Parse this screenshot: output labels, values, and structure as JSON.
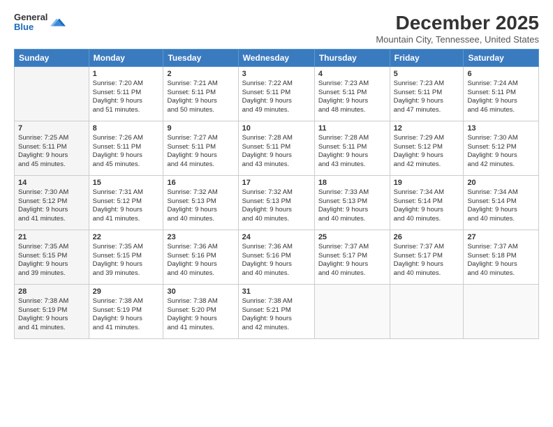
{
  "logo": {
    "general": "General",
    "blue": "Blue"
  },
  "header": {
    "title": "December 2025",
    "location": "Mountain City, Tennessee, United States"
  },
  "weekdays": [
    "Sunday",
    "Monday",
    "Tuesday",
    "Wednesday",
    "Thursday",
    "Friday",
    "Saturday"
  ],
  "weeks": [
    [
      {
        "day": "",
        "content": ""
      },
      {
        "day": "1",
        "content": "Sunrise: 7:20 AM\nSunset: 5:11 PM\nDaylight: 9 hours\nand 51 minutes."
      },
      {
        "day": "2",
        "content": "Sunrise: 7:21 AM\nSunset: 5:11 PM\nDaylight: 9 hours\nand 50 minutes."
      },
      {
        "day": "3",
        "content": "Sunrise: 7:22 AM\nSunset: 5:11 PM\nDaylight: 9 hours\nand 49 minutes."
      },
      {
        "day": "4",
        "content": "Sunrise: 7:23 AM\nSunset: 5:11 PM\nDaylight: 9 hours\nand 48 minutes."
      },
      {
        "day": "5",
        "content": "Sunrise: 7:23 AM\nSunset: 5:11 PM\nDaylight: 9 hours\nand 47 minutes."
      },
      {
        "day": "6",
        "content": "Sunrise: 7:24 AM\nSunset: 5:11 PM\nDaylight: 9 hours\nand 46 minutes."
      }
    ],
    [
      {
        "day": "7",
        "content": "Sunrise: 7:25 AM\nSunset: 5:11 PM\nDaylight: 9 hours\nand 45 minutes."
      },
      {
        "day": "8",
        "content": "Sunrise: 7:26 AM\nSunset: 5:11 PM\nDaylight: 9 hours\nand 45 minutes."
      },
      {
        "day": "9",
        "content": "Sunrise: 7:27 AM\nSunset: 5:11 PM\nDaylight: 9 hours\nand 44 minutes."
      },
      {
        "day": "10",
        "content": "Sunrise: 7:28 AM\nSunset: 5:11 PM\nDaylight: 9 hours\nand 43 minutes."
      },
      {
        "day": "11",
        "content": "Sunrise: 7:28 AM\nSunset: 5:11 PM\nDaylight: 9 hours\nand 43 minutes."
      },
      {
        "day": "12",
        "content": "Sunrise: 7:29 AM\nSunset: 5:12 PM\nDaylight: 9 hours\nand 42 minutes."
      },
      {
        "day": "13",
        "content": "Sunrise: 7:30 AM\nSunset: 5:12 PM\nDaylight: 9 hours\nand 42 minutes."
      }
    ],
    [
      {
        "day": "14",
        "content": "Sunrise: 7:30 AM\nSunset: 5:12 PM\nDaylight: 9 hours\nand 41 minutes."
      },
      {
        "day": "15",
        "content": "Sunrise: 7:31 AM\nSunset: 5:12 PM\nDaylight: 9 hours\nand 41 minutes."
      },
      {
        "day": "16",
        "content": "Sunrise: 7:32 AM\nSunset: 5:13 PM\nDaylight: 9 hours\nand 40 minutes."
      },
      {
        "day": "17",
        "content": "Sunrise: 7:32 AM\nSunset: 5:13 PM\nDaylight: 9 hours\nand 40 minutes."
      },
      {
        "day": "18",
        "content": "Sunrise: 7:33 AM\nSunset: 5:13 PM\nDaylight: 9 hours\nand 40 minutes."
      },
      {
        "day": "19",
        "content": "Sunrise: 7:34 AM\nSunset: 5:14 PM\nDaylight: 9 hours\nand 40 minutes."
      },
      {
        "day": "20",
        "content": "Sunrise: 7:34 AM\nSunset: 5:14 PM\nDaylight: 9 hours\nand 40 minutes."
      }
    ],
    [
      {
        "day": "21",
        "content": "Sunrise: 7:35 AM\nSunset: 5:15 PM\nDaylight: 9 hours\nand 39 minutes."
      },
      {
        "day": "22",
        "content": "Sunrise: 7:35 AM\nSunset: 5:15 PM\nDaylight: 9 hours\nand 39 minutes."
      },
      {
        "day": "23",
        "content": "Sunrise: 7:36 AM\nSunset: 5:16 PM\nDaylight: 9 hours\nand 40 minutes."
      },
      {
        "day": "24",
        "content": "Sunrise: 7:36 AM\nSunset: 5:16 PM\nDaylight: 9 hours\nand 40 minutes."
      },
      {
        "day": "25",
        "content": "Sunrise: 7:37 AM\nSunset: 5:17 PM\nDaylight: 9 hours\nand 40 minutes."
      },
      {
        "day": "26",
        "content": "Sunrise: 7:37 AM\nSunset: 5:17 PM\nDaylight: 9 hours\nand 40 minutes."
      },
      {
        "day": "27",
        "content": "Sunrise: 7:37 AM\nSunset: 5:18 PM\nDaylight: 9 hours\nand 40 minutes."
      }
    ],
    [
      {
        "day": "28",
        "content": "Sunrise: 7:38 AM\nSunset: 5:19 PM\nDaylight: 9 hours\nand 41 minutes."
      },
      {
        "day": "29",
        "content": "Sunrise: 7:38 AM\nSunset: 5:19 PM\nDaylight: 9 hours\nand 41 minutes."
      },
      {
        "day": "30",
        "content": "Sunrise: 7:38 AM\nSunset: 5:20 PM\nDaylight: 9 hours\nand 41 minutes."
      },
      {
        "day": "31",
        "content": "Sunrise: 7:38 AM\nSunset: 5:21 PM\nDaylight: 9 hours\nand 42 minutes."
      },
      {
        "day": "",
        "content": ""
      },
      {
        "day": "",
        "content": ""
      },
      {
        "day": "",
        "content": ""
      }
    ]
  ]
}
